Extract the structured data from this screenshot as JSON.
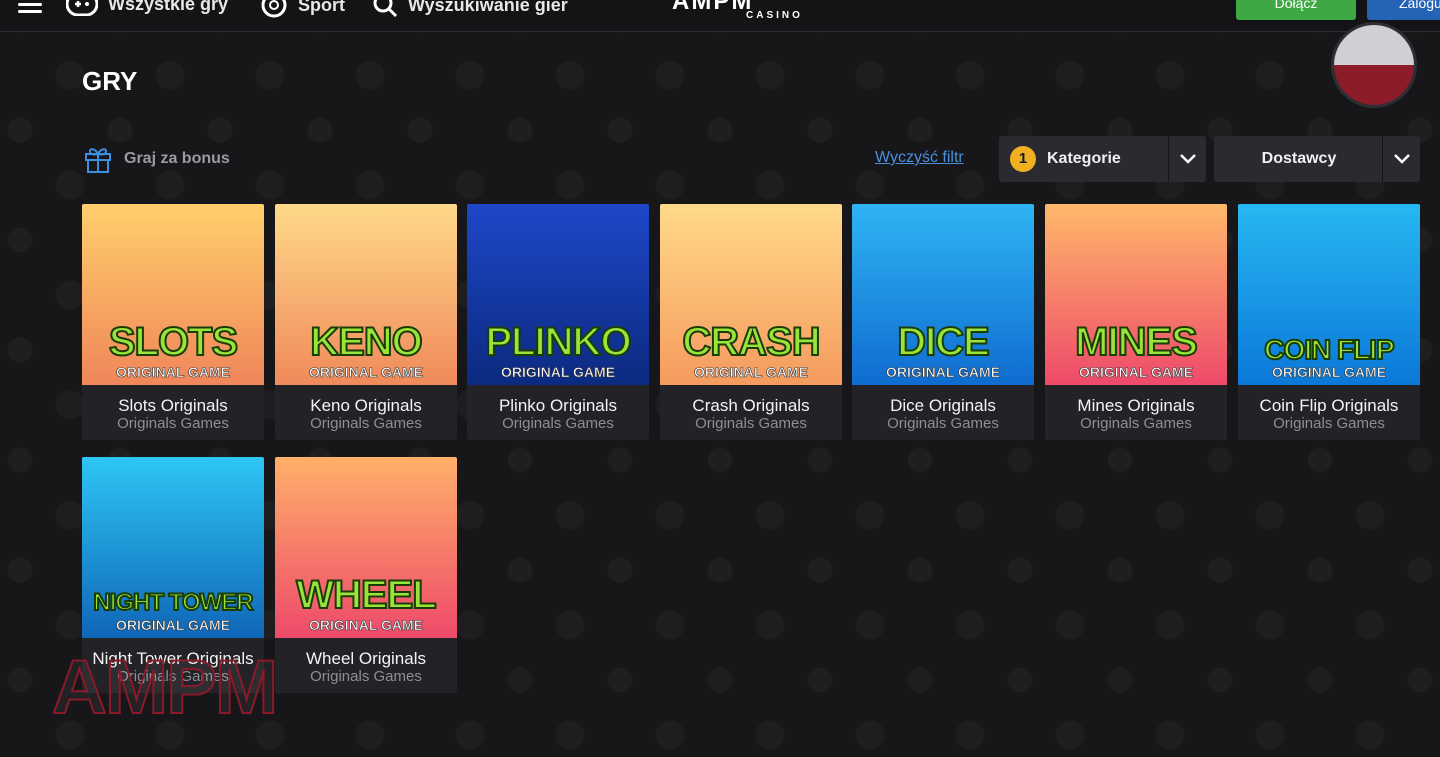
{
  "nav": {
    "all_games": "Wszystkie gry",
    "sport": "Sport",
    "search": "Wyszukiwanie gier"
  },
  "logo": {
    "main": "AMPM",
    "sub": "CASINO"
  },
  "header_buttons": {
    "join": "Dołącz",
    "login": "Zaloguj"
  },
  "colors": {
    "join": "#3ea944",
    "login": "#2563b7",
    "badge": "#f0b020",
    "link": "#4a8fe0"
  },
  "page_title": "GRY",
  "bonus_label": "Graj za bonus",
  "clear_filter": "Wyczyść filtr",
  "filters": {
    "categories_count": "1",
    "categories_label": "Kategorie",
    "providers_label": "Dostawcy"
  },
  "games": [
    {
      "thumb_title": "SLOTS",
      "thumb_sub": "ORIGINAL GAME",
      "name": "Slots Originals",
      "category": "Originals Games",
      "colors": [
        "#ffcf6b",
        "#f0865a"
      ]
    },
    {
      "thumb_title": "KENO",
      "thumb_sub": "ORIGINAL GAME",
      "name": "Keno Originals",
      "category": "Originals Games",
      "colors": [
        "#ffd98a",
        "#f08a5a"
      ]
    },
    {
      "thumb_title": "PLINKO",
      "thumb_sub": "ORIGINAL GAME",
      "name": "Plinko Originals",
      "category": "Originals Games",
      "colors": [
        "#1e47c8",
        "#0b2a80"
      ]
    },
    {
      "thumb_title": "CRASH",
      "thumb_sub": "ORIGINAL GAME",
      "name": "Crash Originals",
      "category": "Originals Games",
      "colors": [
        "#ffd98a",
        "#f59a5e"
      ]
    },
    {
      "thumb_title": "DICE",
      "thumb_sub": "ORIGINAL GAME",
      "name": "Dice Originals",
      "category": "Originals Games",
      "colors": [
        "#2fb4f4",
        "#0f6cd0"
      ]
    },
    {
      "thumb_title": "MINES",
      "thumb_sub": "ORIGINAL GAME",
      "name": "Mines Originals",
      "category": "Originals Games",
      "colors": [
        "#ffb86a",
        "#ee4a6a"
      ]
    },
    {
      "thumb_title": "COIN FLIP",
      "thumb_sub": "ORIGINAL GAME",
      "name": "Coin Flip Originals",
      "category": "Originals Games",
      "colors": [
        "#27b8f2",
        "#0b78d8"
      ]
    },
    {
      "thumb_title": "NIGHT TOWER",
      "thumb_sub": "ORIGINAL GAME",
      "name": "Night Tower Originals",
      "category": "Originals Games",
      "colors": [
        "#2ec6f4",
        "#0f66b8"
      ]
    },
    {
      "thumb_title": "WHEEL",
      "thumb_sub": "ORIGINAL GAME",
      "name": "Wheel Originals",
      "category": "Originals Games",
      "colors": [
        "#ffb06a",
        "#ee4a6a"
      ]
    }
  ],
  "watermark": "AMPM"
}
